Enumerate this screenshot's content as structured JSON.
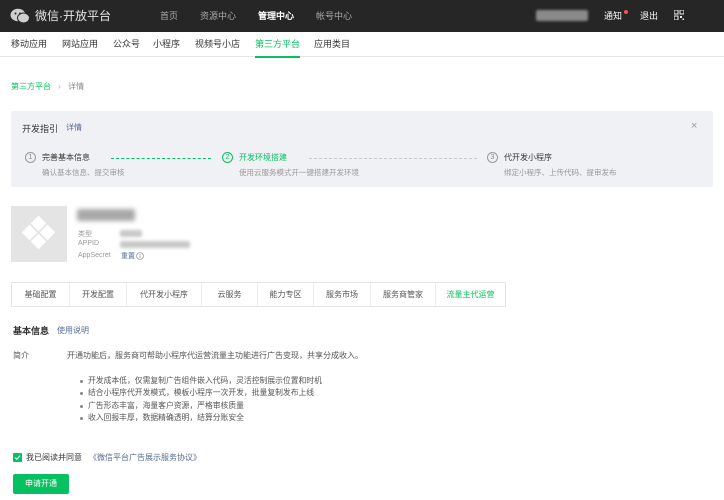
{
  "header": {
    "logo_text": "微信·开放平台",
    "nav": [
      "首页",
      "资源中心",
      "管理中心",
      "帐号中心"
    ],
    "active_nav": "管理中心",
    "notice": "通知",
    "logout": "退出"
  },
  "subnav": {
    "items": [
      "移动应用",
      "网站应用",
      "公众号",
      "小程序",
      "视频号小店",
      "第三方平台",
      "应用类目"
    ],
    "active": "第三方平台"
  },
  "breadcrumb": {
    "parent": "第三方平台",
    "current": "详情"
  },
  "guide": {
    "title": "开发指引",
    "link": "详情",
    "close": "×",
    "steps": [
      {
        "num": "1",
        "title": "完善基本信息",
        "desc": "确认基本信息、提交审核"
      },
      {
        "num": "2",
        "title": "开发环境搭建",
        "desc": "使用云服务模式开一键搭建开发环境"
      },
      {
        "num": "3",
        "title": "代开发小程序",
        "desc": "绑定小程序、上传代码、提审发布"
      }
    ]
  },
  "app": {
    "labels": {
      "type": "类型",
      "appid": "APPID",
      "secret": "AppSecret"
    },
    "reset": "重置"
  },
  "tabs": {
    "items": [
      "基础配置",
      "开发配置",
      "代开发小程序",
      "云服务",
      "能力专区",
      "服务市场",
      "服务商管家",
      "流量主代运营"
    ],
    "active": "流量主代运营"
  },
  "basic": {
    "title": "基本信息",
    "usage_link": "使用说明",
    "intro_label": "简介",
    "intro_text": "开通功能后，服务商可帮助小程序代运营流量主功能进行广告变现，共享分成收入。",
    "bullets": [
      "开发成本低，仅需复制广告组件嵌入代码，灵活控制展示位置和时机",
      "结合小程序代开发模式，模板小程序一次开发，批量复制发布上线",
      "广告形态丰富，海量客户资源，严格审核质量",
      "收入回报丰厚，数据精确透明，结算分账安全"
    ]
  },
  "agreement": {
    "text": "我已阅读并同意",
    "link": "《微信平台广告展示服务协议》",
    "checked": true
  },
  "apply_button": "申请开通",
  "colors": {
    "accent": "#07c160",
    "link": "#576b95",
    "topbar": "#262626"
  }
}
